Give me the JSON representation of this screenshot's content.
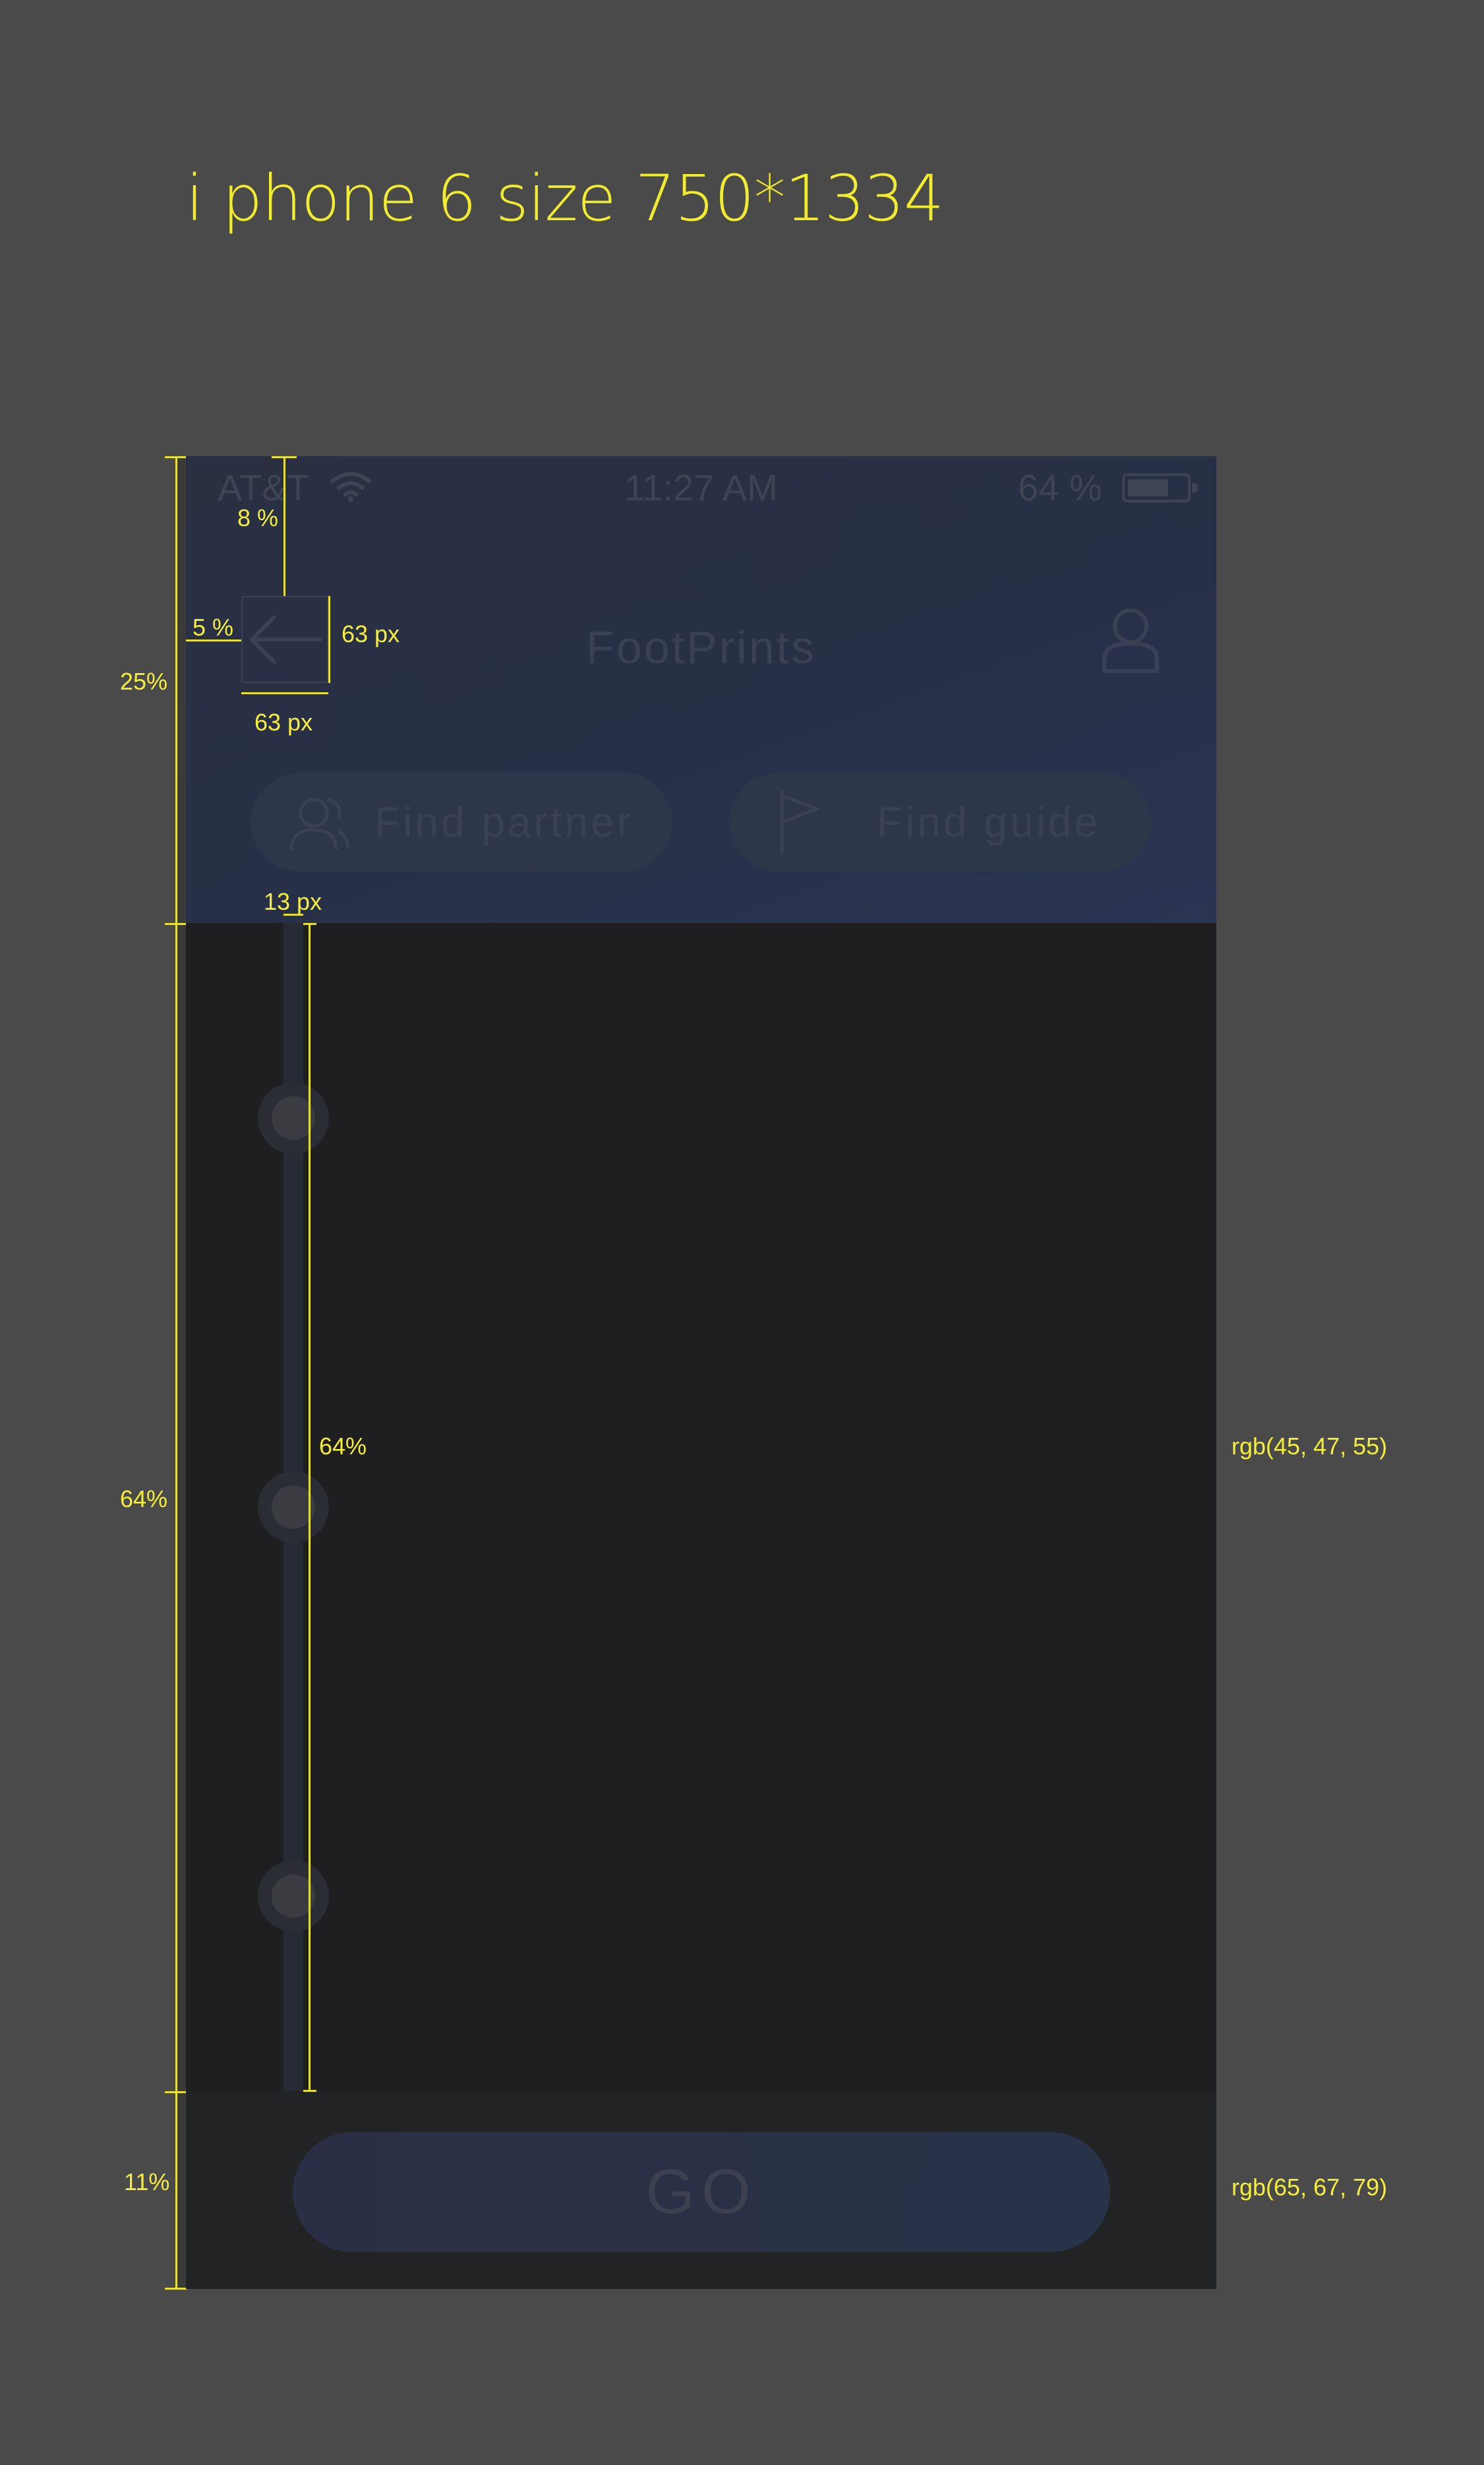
{
  "spec_title": "i phone 6 size 750*1334",
  "annotations": {
    "header_height": "25%",
    "content_height": "64%",
    "content_height_inner": "64%",
    "footer_height": "11%",
    "top_offset": "8 %",
    "left_offset": "5 %",
    "back_height": "63 px",
    "back_width": "63 px",
    "track_width": "13 px",
    "content_color": "rgb(45, 47, 55)",
    "footer_color": "rgb(65, 67, 79)"
  },
  "status_bar": {
    "carrier": "AT&T",
    "time": "11:27 AM",
    "battery": "64 %",
    "battery_level": 0.64
  },
  "header": {
    "title": "FootPrints",
    "find_partner": "Find partner",
    "find_guide": "Find guide"
  },
  "footer": {
    "go_label": "GO"
  },
  "icons": {
    "back": "arrow-left-icon",
    "profile": "user-icon",
    "partner": "people-icon",
    "guide": "flag-icon",
    "wifi": "wifi-icon",
    "battery": "battery-icon"
  }
}
